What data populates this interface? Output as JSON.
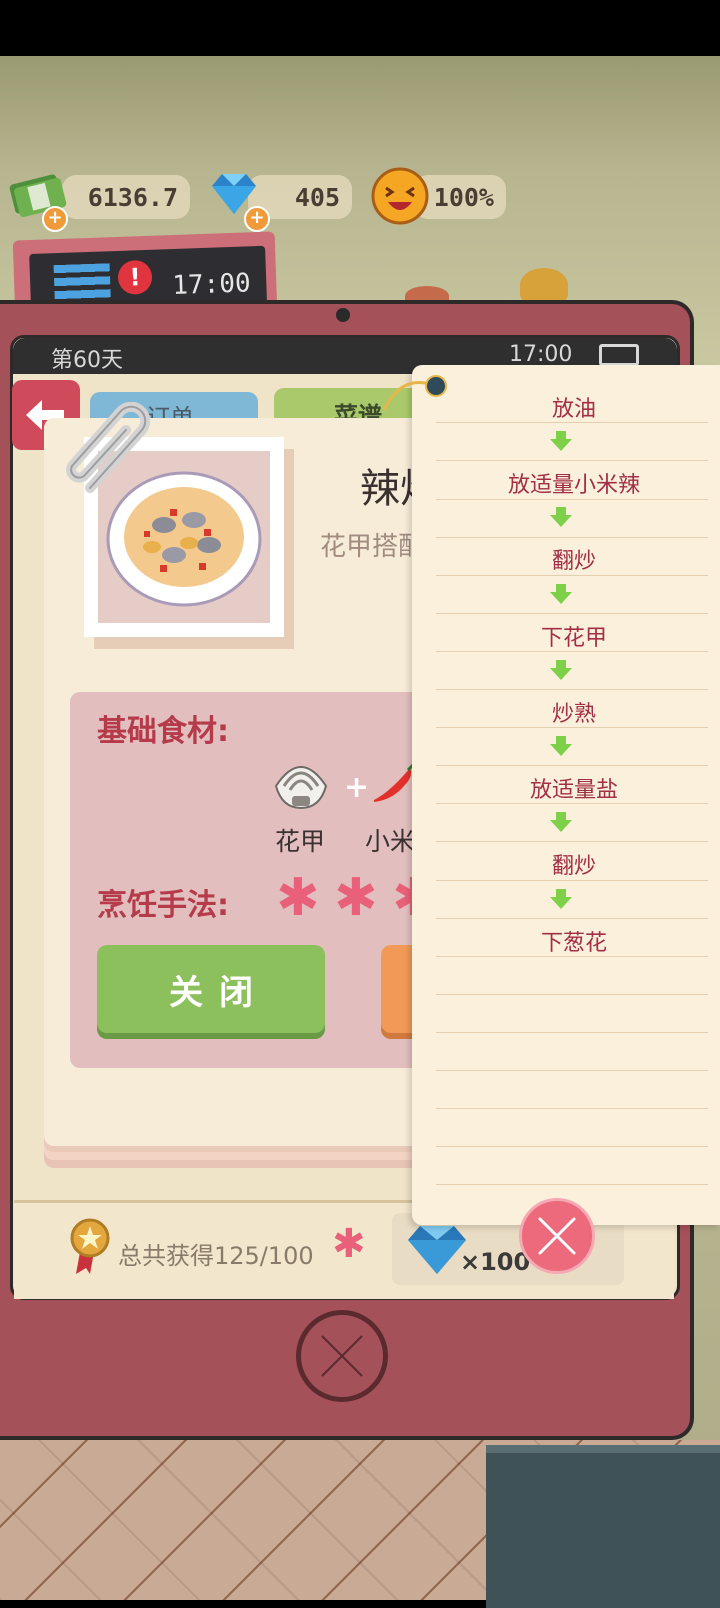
{
  "hud": {
    "money": "6136.7",
    "gems": "405",
    "satisfaction": "100%",
    "clock_sign": "17:00"
  },
  "tablet": {
    "day": "第60天",
    "time": "17:00",
    "tabs": [
      "订单",
      "菜谱"
    ]
  },
  "recipe": {
    "title": "辣炒",
    "subtitle": "花甲搭配",
    "base_ingredients_label": "基础食材:",
    "ingredients": [
      "花甲",
      "小米"
    ],
    "technique_label": "烹饪手法:",
    "close_label": "关闭"
  },
  "steps": [
    "放油",
    "放适量小米辣",
    "翻炒",
    "下花甲",
    "炒熟",
    "放适量盐",
    "翻炒",
    "下葱花"
  ],
  "footer": {
    "total_earned": "总共获得125/100",
    "reward": "×100"
  },
  "colors": {
    "accent": "#a55159",
    "step_text": "#a22f45",
    "close_button": "#8cc05c"
  }
}
